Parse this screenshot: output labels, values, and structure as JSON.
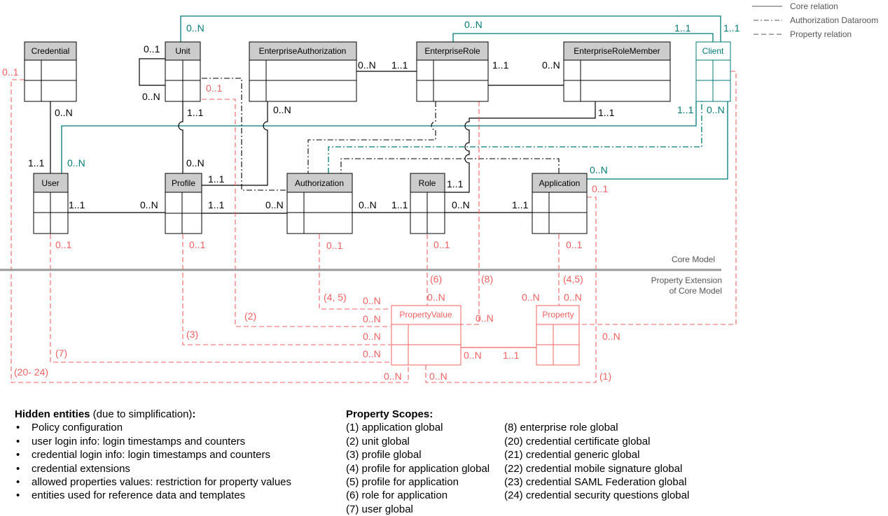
{
  "colors": {
    "core": "#000000",
    "teal": "#007a78",
    "property": "#f06060",
    "header_fill": "#cccccc",
    "divider": "#999999",
    "legend_text": "#555555"
  },
  "legend": {
    "items": [
      {
        "style": "solid",
        "label": "Core relation"
      },
      {
        "style": "dash-dot",
        "label": "Authorization Dataroom"
      },
      {
        "style": "dashed",
        "label": "Property relation"
      }
    ]
  },
  "sections": {
    "core_model": "Core Model",
    "property_extension_line1": "Property Extension",
    "property_extension_line2": "of Core Model"
  },
  "entities": {
    "credential": "Credential",
    "unit": "Unit",
    "enterprise_authorization": "EnterpriseAuthorization",
    "enterprise_role": "EnterpriseRole",
    "enterprise_role_member": "EnterpriseRoleMember",
    "client": "Client",
    "user": "User",
    "profile": "Profile",
    "authorization": "Authorization",
    "role": "Role",
    "application": "Application",
    "property_value": "PropertyValue",
    "property": "Property"
  },
  "multiplicities": {
    "unit_client_top": "0..N",
    "erole_client_top": "0..N",
    "client_top_left": "1..1",
    "client_top_right": "1..1",
    "unit_self_top": "0..1",
    "unit_self_bottom": "0..N",
    "credential_left": "0..1",
    "unit_right_prop": "0..1",
    "credential_bottom": "0..N",
    "unit_bottom": "1..1",
    "ea_bottom": "0..N",
    "ea_right": "0..N",
    "erole_left": "1..1",
    "erole_right": "1..1",
    "erm_left": "0..N",
    "erm_bottom": "1..1",
    "client_bottom_left": "1..1",
    "client_bottom_right": "0..N",
    "user_top": "1..1",
    "user_top_teal": "0..N",
    "profile_top": "0..N",
    "profile_right_top": "1..1",
    "role_right": "1..1",
    "app_right_teal": "0..N",
    "app_right_prop": "0..1",
    "user_right": "1..1",
    "profile_left": "0..N",
    "profile_right": "1..1",
    "auth_left": "0..N",
    "auth_right": "0..N",
    "role_left": "1..1",
    "role_right_bottom": "0..N",
    "app_left": "1..1",
    "user_bottom": "0..1",
    "profile_bottom": "0..1",
    "auth_bottom": "0..1",
    "role_bottom": "0..1",
    "app_bottom": "0..1",
    "pv_in_45": "0..N",
    "pv_in_2": "0..N",
    "pv_in_3": "0..N",
    "pv_in_7": "0..N",
    "pv_top_6": "0..N",
    "pv_right_8": "0..N",
    "prop_top_left": "0..N",
    "prop_top": "0..N",
    "pv_bottom_left": "0..N",
    "pv_bottom_right": "0..N",
    "pv_to_prop": "0..N",
    "prop_from_pv": "1..1",
    "prop_right": "0..N"
  },
  "scope_labels": {
    "s45_left": "(4, 5)",
    "s2": "(2)",
    "s3": "(3)",
    "s7": "(7)",
    "s20_24": "(20- 24)",
    "s6": "(6)",
    "s8": "(8)",
    "s45_right": "(4,5)",
    "s1": "(1)"
  },
  "hidden_entities": {
    "title_bold": "Hidden entities",
    "title_rest": " (due to simplification)",
    "title_colon": ":",
    "bullet": "•",
    "items": [
      "Policy configuration",
      "user login info: login timestamps and counters",
      "credential login info: login timestamps and counters",
      "credential extensions",
      "allowed properties values: restriction for property values",
      "entities used for reference data and templates"
    ]
  },
  "property_scopes": {
    "title": "Property Scopes:",
    "col1": [
      "(1) application global",
      "(2) unit global",
      "(3) profile global",
      "(4) profile for application global",
      "(5) profile for application",
      "(6) role for application",
      "(7) user global"
    ],
    "col2": [
      "(8) enterprise role global",
      "(20) credential certificate global",
      "(21) credential generic global",
      "(22) credential mobile signature global",
      "(23) credential SAML Federation global",
      "(24) credential security questions global"
    ]
  }
}
